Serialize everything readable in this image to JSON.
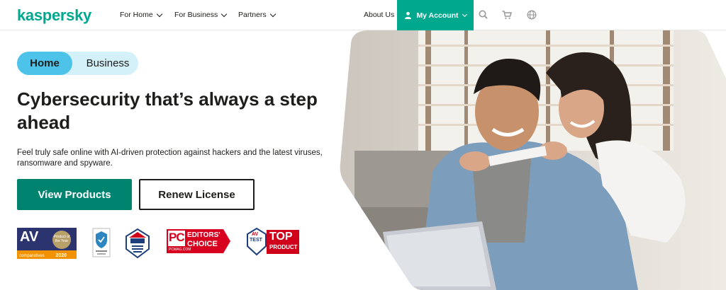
{
  "header": {
    "logo": "kaspersky",
    "nav": [
      "For Home",
      "For Business",
      "Partners"
    ],
    "about": "About Us",
    "account": "My Account",
    "icons": [
      "search-icon",
      "cart-icon",
      "globe-icon"
    ]
  },
  "hero": {
    "toggle": {
      "home": "Home",
      "business": "Business"
    },
    "headline": "Cybersecurity that’s always a step ahead",
    "subtext": "Feel truly safe online with AI-driven protection against hackers and the latest viruses, ransomware and spyware.",
    "primary_button": "View Products",
    "secondary_button": "Renew License"
  },
  "awards": {
    "av_comparatives": {
      "big": "AV",
      "product": "Product of the Year",
      "brand": "comparatives",
      "year": "2020"
    },
    "pc_mag": {
      "pc": "PC",
      "line1": "EDITORS'",
      "line2": "CHOICE",
      "small": "PCMAG.COM"
    },
    "av_test": {
      "av": "AV",
      "test": "TEST",
      "top": "TOP",
      "product": "PRODUCT"
    }
  },
  "colors": {
    "brand_green": "#00a88e",
    "button_green": "#00836f",
    "toggle_active": "#4ec3ea",
    "toggle_bg": "#d4f0f8"
  }
}
